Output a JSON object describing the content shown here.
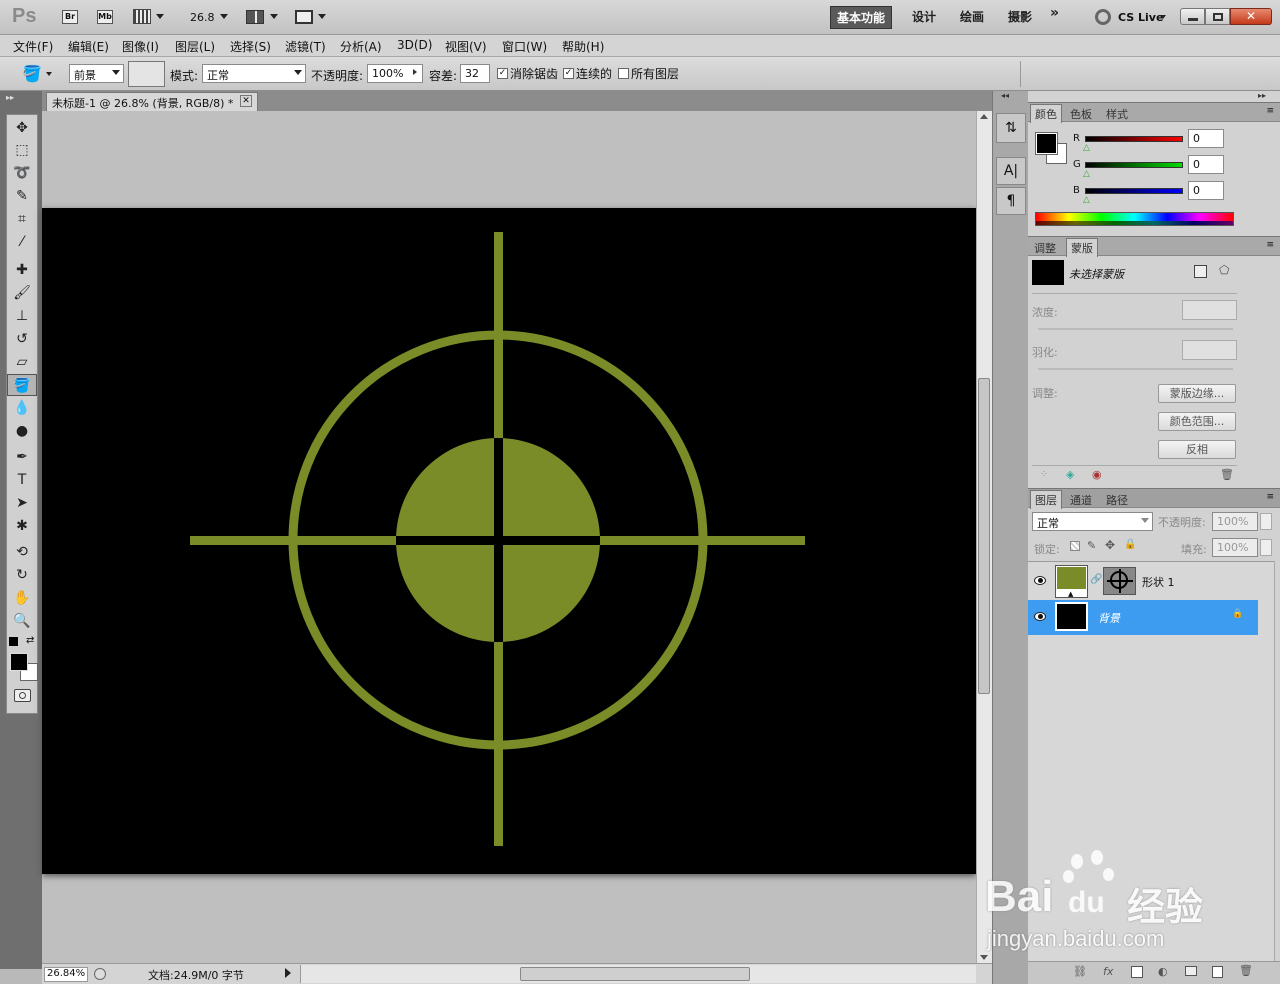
{
  "appbar": {
    "logo": "Ps",
    "br": "Br",
    "mb": "Mb",
    "zoom": "26.8",
    "workspaces": [
      "基本功能",
      "设计",
      "绘画",
      "摄影"
    ],
    "more": "»",
    "cs_live": "CS Live"
  },
  "menu": [
    "文件(F)",
    "编辑(E)",
    "图像(I)",
    "图层(L)",
    "选择(S)",
    "滤镜(T)",
    "分析(A)",
    "3D(D)",
    "视图(V)",
    "窗口(W)",
    "帮助(H)"
  ],
  "options": {
    "fill_source": "前景",
    "mode_label": "模式:",
    "mode_value": "正常",
    "opacity_label": "不透明度:",
    "opacity_value": "100%",
    "tolerance_label": "容差:",
    "tolerance_value": "32",
    "antialias": "消除锯齿",
    "contiguous": "连续的",
    "all_layers": "所有图层",
    "antialias_checked": true,
    "contiguous_checked": true,
    "all_layers_checked": false
  },
  "document": {
    "tab_title": "未标题-1 @ 26.8% (背景, RGB/8) *",
    "background_color": "#000000",
    "target_color": "#7a8c28"
  },
  "status": {
    "zoom": "26.84%",
    "doc_info": "文档:24.9M/0 字节"
  },
  "color_panel": {
    "tabs": [
      "颜色",
      "色板",
      "样式"
    ],
    "channels": [
      {
        "label": "R",
        "value": "0"
      },
      {
        "label": "G",
        "value": "0"
      },
      {
        "label": "B",
        "value": "0"
      }
    ]
  },
  "masks_panel": {
    "tabs": [
      "调整",
      "蒙版"
    ],
    "title": "未选择蒙版",
    "density_label": "浓度:",
    "feather_label": "羽化:",
    "refine_label": "调整:",
    "buttons": [
      "蒙版边缘...",
      "颜色范围...",
      "反相"
    ]
  },
  "layers_panel": {
    "tabs": [
      "图层",
      "通道",
      "路径"
    ],
    "blend_mode": "正常",
    "opacity_label": "不透明度:",
    "opacity_value": "100%",
    "lock_label": "锁定:",
    "fill_label": "填充:",
    "fill_value": "100%",
    "layers": [
      {
        "name": "形状 1",
        "selected": false
      },
      {
        "name": "背景",
        "selected": true
      }
    ]
  },
  "watermark": {
    "brand": "Bai",
    "brand2": "du",
    "suffix": "经验",
    "url": "jingyan.baidu.com"
  }
}
